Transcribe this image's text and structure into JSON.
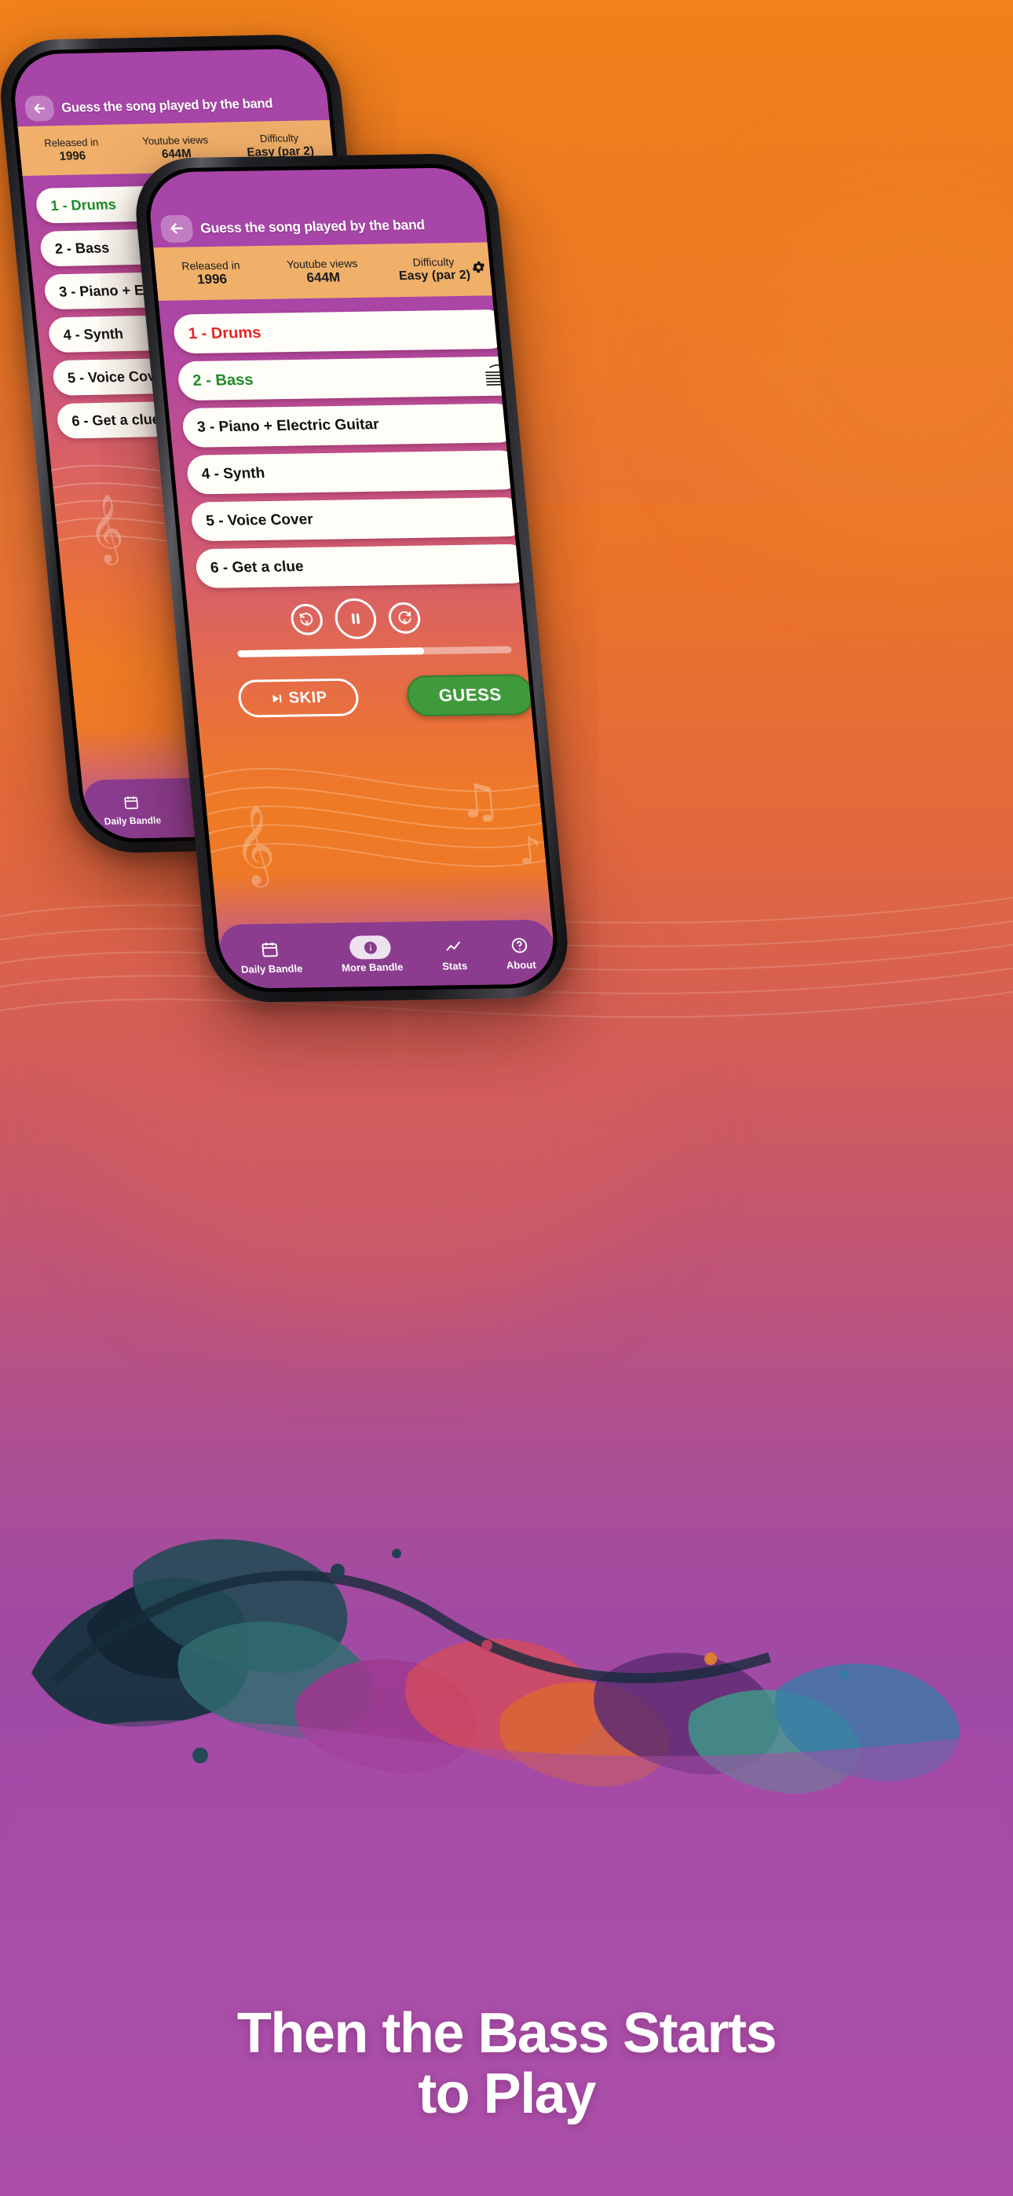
{
  "background": {
    "gradient_top": "#f0811b",
    "gradient_bottom": "#ab4fa9",
    "accent_purple": "#a845a8",
    "accent_orange": "#ee7826"
  },
  "marketing": {
    "line1": "Then the Bass Starts",
    "line2": "to Play"
  },
  "app": {
    "header": {
      "back_icon": "arrow-left-icon",
      "title": "Guess the song played by the band"
    },
    "settings_icon": "gear-icon",
    "stats": [
      {
        "label": "Released in",
        "value": "1996"
      },
      {
        "label": "Youtube views",
        "value": "644M"
      },
      {
        "label": "Difficulty",
        "value": "Easy (par 2)"
      }
    ],
    "options": [
      {
        "label": "1 - Drums",
        "state": "red"
      },
      {
        "label": "2 - Bass",
        "state": "green"
      },
      {
        "label": "3 - Piano + Electric Guitar",
        "state": "normal"
      },
      {
        "label": "4 - Synth",
        "state": "normal"
      },
      {
        "label": "5 - Voice Cover",
        "state": "normal"
      },
      {
        "label": "6 - Get a clue",
        "state": "normal"
      }
    ],
    "transport": {
      "rewind_icon": "rewind-5-icon",
      "rewind_seconds": "5",
      "pause_icon": "pause-icon",
      "forward_icon": "forward-5-icon",
      "forward_seconds": "5",
      "progress_percent": 68
    },
    "actions": {
      "skip_icon": "skip-next-icon",
      "skip_label": "SKIP",
      "guess_label": "GUESS",
      "guess_color": "#3f9a3c"
    },
    "tabs": [
      {
        "label": "Daily Bandle",
        "icon": "calendar-icon",
        "active": false
      },
      {
        "label": "More Bandle",
        "icon": "info-icon",
        "active": true
      },
      {
        "label": "Stats",
        "icon": "chart-icon",
        "active": false
      },
      {
        "label": "About",
        "icon": "question-icon",
        "active": false
      }
    ],
    "cursor_icon": "pointing-hand-icon"
  }
}
